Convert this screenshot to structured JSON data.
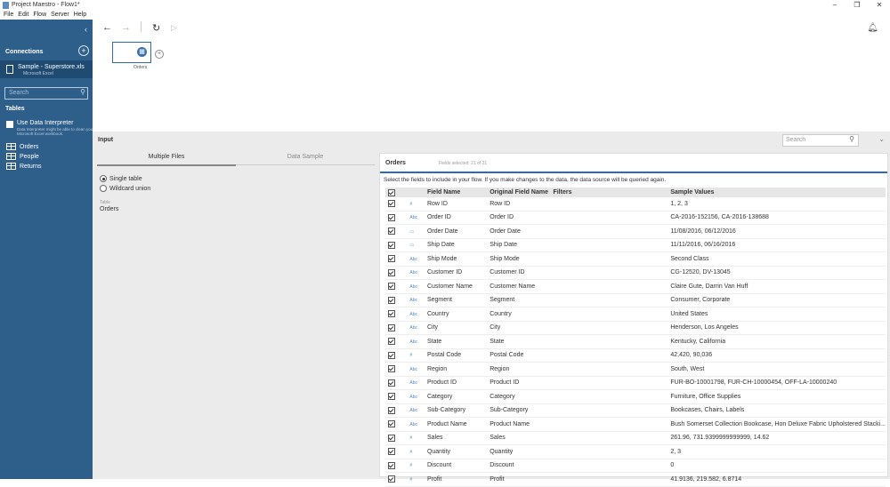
{
  "window": {
    "title": "Project Maestro - Flow1*",
    "controls": [
      "–",
      "❐",
      "✕"
    ]
  },
  "menu": [
    "File",
    "Edit",
    "Flow",
    "Server",
    "Help"
  ],
  "sidebar": {
    "connections_label": "Connections",
    "connection": {
      "name": "Sample - Superstore.xls",
      "type": "Microsoft Excel"
    },
    "search_placeholder": "Search",
    "tables_label": "Tables",
    "interpreter_label": "Use Data Interpreter",
    "interpreter_desc": "Data Interpreter might be able to clean your Microsoft Excel workbook.",
    "tables": [
      "Orders",
      "People",
      "Returns"
    ]
  },
  "canvas": {
    "node_label": "Orders"
  },
  "input": {
    "title": "Input",
    "search_placeholder": "Search",
    "tabs": [
      "Multiple Files",
      "Data Sample"
    ],
    "options": [
      "Single table",
      "Wildcard union"
    ],
    "table_caption": "Table",
    "table_value": "Orders"
  },
  "grid": {
    "title": "Orders",
    "fields_selected": "Fields selected: 21 of 21",
    "instruction": "Select the fields to include in your flow. If you make changes to the data, the data source will be queried again.",
    "headers": [
      "Field Name",
      "Original Field Name",
      "Filters",
      "Sample Values"
    ],
    "rows": [
      {
        "type": "#",
        "field": "Row ID",
        "orig": "Row ID",
        "sample": "1, 2, 3"
      },
      {
        "type": "Abc",
        "field": "Order ID",
        "orig": "Order ID",
        "sample": "CA-2016-152156, CA-2016-138688"
      },
      {
        "type": "▭",
        "field": "Order Date",
        "orig": "Order Date",
        "sample": "11/08/2016, 06/12/2016"
      },
      {
        "type": "▭",
        "field": "Ship Date",
        "orig": "Ship Date",
        "sample": "11/11/2016, 06/16/2016"
      },
      {
        "type": "Abc",
        "field": "Ship Mode",
        "orig": "Ship Mode",
        "sample": "Second Class"
      },
      {
        "type": "Abc",
        "field": "Customer ID",
        "orig": "Customer ID",
        "sample": "CG-12520, DV-13045"
      },
      {
        "type": "Abc",
        "field": "Customer Name",
        "orig": "Customer Name",
        "sample": "Claire Gute, Darrin Van Huff"
      },
      {
        "type": "Abc",
        "field": "Segment",
        "orig": "Segment",
        "sample": "Consumer, Corporate"
      },
      {
        "type": "Abc",
        "field": "Country",
        "orig": "Country",
        "sample": "United States"
      },
      {
        "type": "Abc",
        "field": "City",
        "orig": "City",
        "sample": "Henderson, Los Angeles"
      },
      {
        "type": "Abc",
        "field": "State",
        "orig": "State",
        "sample": "Kentucky, California"
      },
      {
        "type": "#",
        "field": "Postal Code",
        "orig": "Postal Code",
        "sample": "42,420, 90,036"
      },
      {
        "type": "Abc",
        "field": "Region",
        "orig": "Region",
        "sample": "South, West"
      },
      {
        "type": "Abc",
        "field": "Product ID",
        "orig": "Product ID",
        "sample": "FUR-BO-10001798, FUR-CH-10000454, OFF-LA-10000240"
      },
      {
        "type": "Abc",
        "field": "Category",
        "orig": "Category",
        "sample": "Furniture, Office Supplies"
      },
      {
        "type": "Abc",
        "field": "Sub-Category",
        "orig": "Sub-Category",
        "sample": "Bookcases, Chairs, Labels"
      },
      {
        "type": "Abc",
        "field": "Product Name",
        "orig": "Product Name",
        "sample": "Bush Somerset Collection Bookcase, Hon Deluxe Fabric Upholstered Stacki..."
      },
      {
        "type": "#",
        "field": "Sales",
        "orig": "Sales",
        "sample": "261.96, 731.9399999999999, 14.62"
      },
      {
        "type": "#",
        "field": "Quantity",
        "orig": "Quantity",
        "sample": "2, 3"
      },
      {
        "type": "#",
        "field": "Discount",
        "orig": "Discount",
        "sample": "0"
      },
      {
        "type": "#",
        "field": "Profit",
        "orig": "Profit",
        "sample": "41.9136, 219.582, 6.8714"
      }
    ]
  }
}
